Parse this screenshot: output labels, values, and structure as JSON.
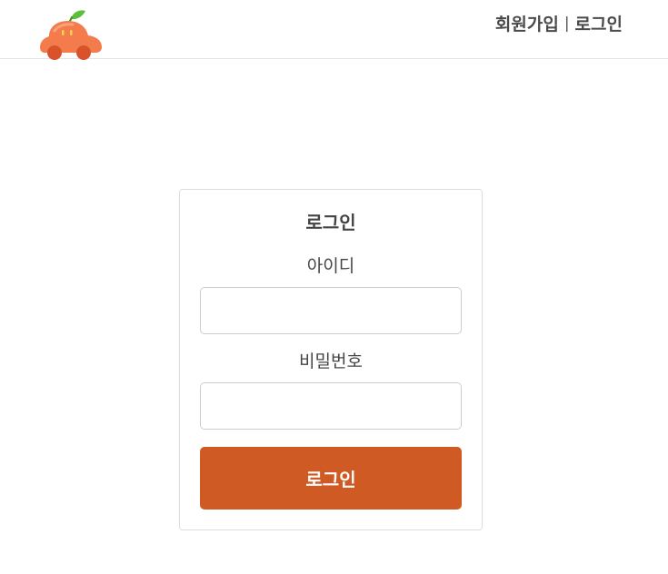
{
  "header": {
    "logo_icon": "tangerine-car-logo-icon",
    "nav": {
      "signup_label": "회원가입",
      "separator": "|",
      "login_label": "로그인"
    }
  },
  "login_form": {
    "title": "로그인",
    "id_label": "아이디",
    "id_value": "",
    "password_label": "비밀번호",
    "password_value": "",
    "submit_label": "로그인"
  },
  "colors": {
    "accent": "#d05a24",
    "logo_orange": "#f47c4c",
    "leaf_green": "#5cbf3a",
    "text": "#444444",
    "border": "#dddddd"
  }
}
